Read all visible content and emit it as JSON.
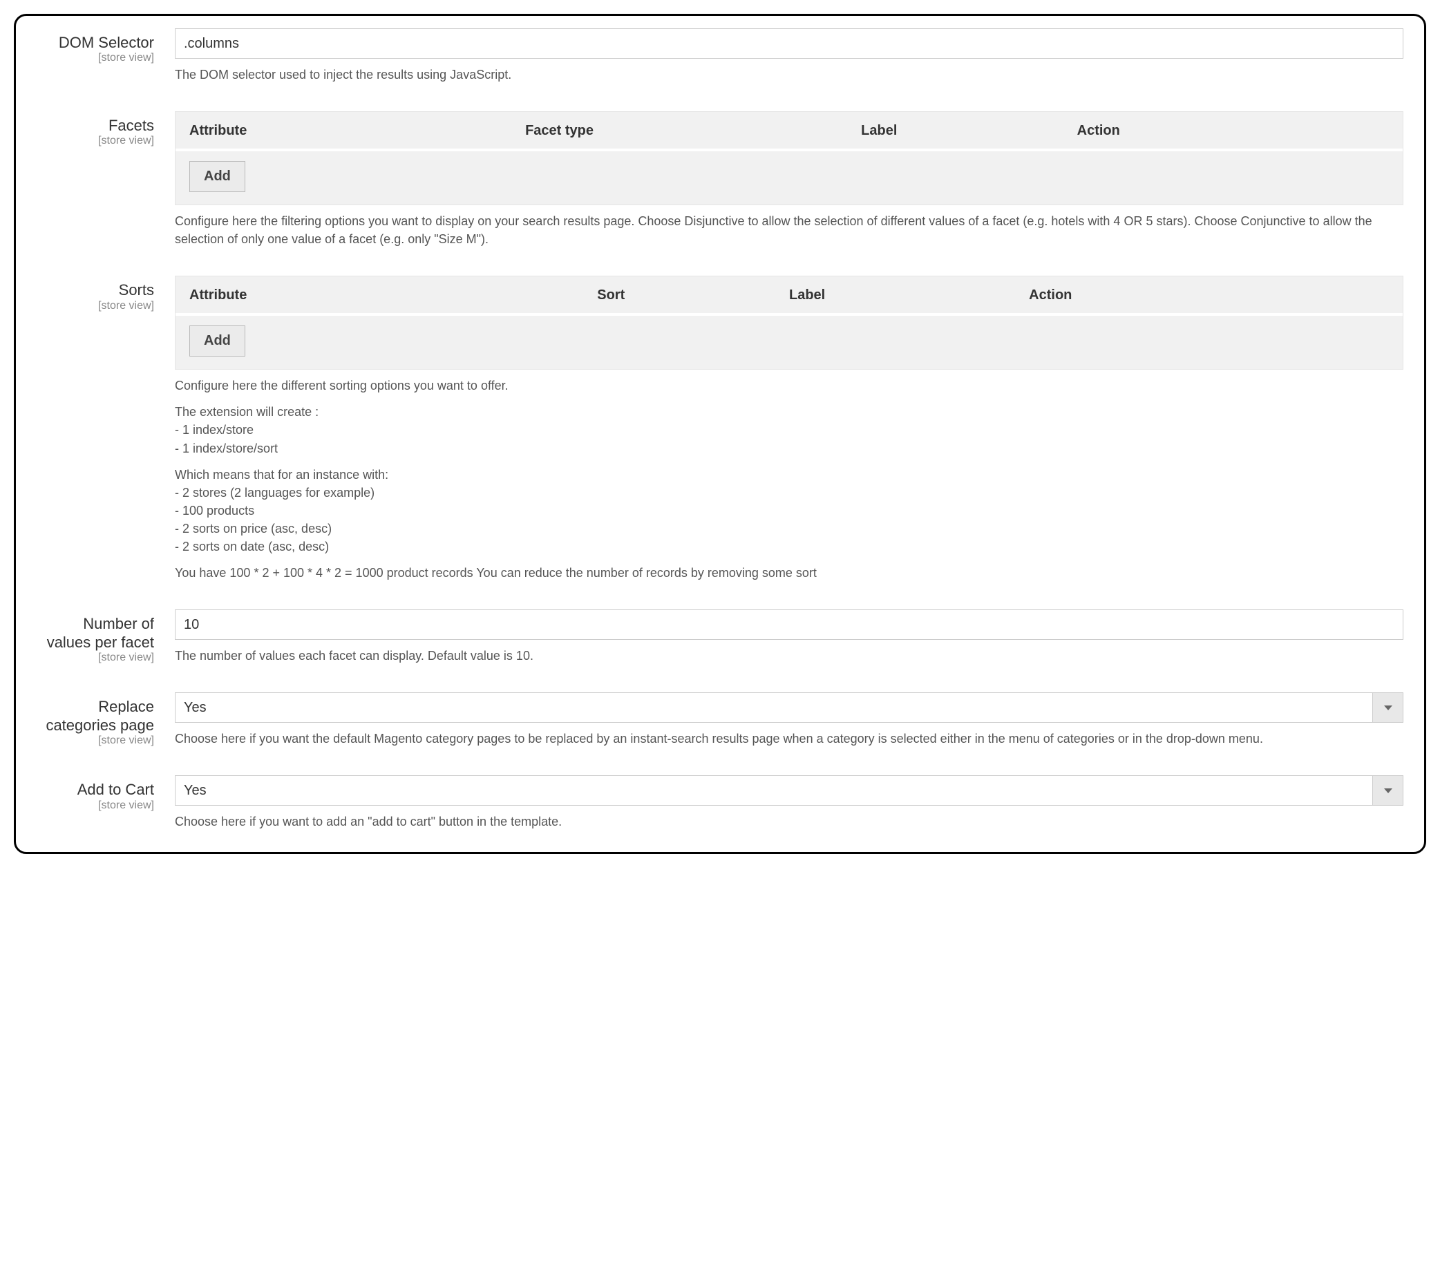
{
  "scope_text": "[store view]",
  "add_button": "Add",
  "dom_selector": {
    "label": "DOM Selector",
    "value": ".columns",
    "help": "The DOM selector used to inject the results using JavaScript."
  },
  "facets": {
    "label": "Facets",
    "headers": {
      "attribute": "Attribute",
      "type": "Facet type",
      "display_label": "Label",
      "action": "Action"
    },
    "help": "Configure here the filtering options you want to display on your search results page. Choose Disjunctive to allow the selection of different values of a facet (e.g. hotels with 4 OR 5 stars). Choose Conjunctive to allow the selection of only one value of a facet (e.g. only \"Size M\")."
  },
  "sorts": {
    "label": "Sorts",
    "headers": {
      "attribute": "Attribute",
      "sort": "Sort",
      "display_label": "Label",
      "action": "Action"
    },
    "help_intro": "Configure here the different sorting options you want to offer.",
    "help_create": "The extension will create :",
    "help_create_l1": "- 1 index/store",
    "help_create_l2": "- 1 index/store/sort",
    "help_means": "Which means that for an instance with:",
    "help_means_l1": "- 2 stores (2 languages for example)",
    "help_means_l2": "- 100 products",
    "help_means_l3": "- 2 sorts on price (asc, desc)",
    "help_means_l4": "- 2 sorts on date (asc, desc)",
    "help_total": "You have 100 * 2 + 100 * 4 * 2 = 1000 product records You can reduce the number of records by removing some sort"
  },
  "num_values": {
    "label": "Number of values per facet",
    "value": "10",
    "help": "The number of values each facet can display. Default value is 10."
  },
  "replace_categories": {
    "label": "Replace categories page",
    "value": "Yes",
    "help": "Choose here if you want the default Magento category pages to be replaced by an instant-search results page when a category is selected either in the menu of categories or in the drop-down menu."
  },
  "add_to_cart": {
    "label": "Add to Cart",
    "value": "Yes",
    "help": "Choose here if you want to add an \"add to cart\" button in the template."
  }
}
